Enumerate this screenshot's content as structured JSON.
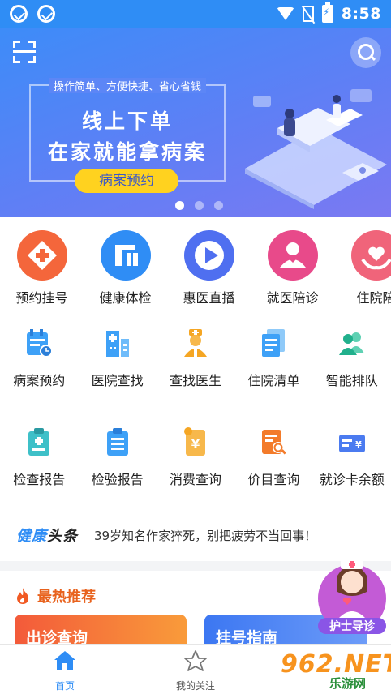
{
  "status_bar": {
    "time": "8:58"
  },
  "banner": {
    "tagline": "操作简单、方便快捷、省心省钱",
    "title_line1": "线上下单",
    "title_line2": "在家就能拿病案",
    "button_label": "病案预约",
    "slide_count": 3,
    "active_slide": 1
  },
  "top_services": [
    {
      "label": "预约挂号",
      "icon": "plus-diamond-icon",
      "color": "#f4663b"
    },
    {
      "label": "健康体检",
      "icon": "checkup-icon",
      "color": "#2f8df5"
    },
    {
      "label": "惠医直播",
      "icon": "play-icon",
      "color": "#4f6ff0"
    },
    {
      "label": "就医陪诊",
      "icon": "companion-icon",
      "color": "#e84a8a"
    },
    {
      "label": "住院陪",
      "icon": "hands-heart-icon",
      "color": "#f0647a"
    }
  ],
  "grid": {
    "row1": [
      {
        "label": "病案预约",
        "icon": "calendar-clock-icon"
      },
      {
        "label": "医院查找",
        "icon": "hospital-building-icon"
      },
      {
        "label": "查找医生",
        "icon": "doctor-icon"
      },
      {
        "label": "住院清单",
        "icon": "list-document-icon"
      },
      {
        "label": "智能排队",
        "icon": "people-queue-icon"
      }
    ],
    "row2": [
      {
        "label": "检查报告",
        "icon": "checkup-report-icon"
      },
      {
        "label": "检验报告",
        "icon": "lab-report-icon"
      },
      {
        "label": "消费查询",
        "icon": "yuan-receipt-icon"
      },
      {
        "label": "价目查询",
        "icon": "price-search-icon"
      },
      {
        "label": "就诊卡余额",
        "icon": "card-yuan-icon"
      }
    ]
  },
  "news": {
    "logo_part1": "健康",
    "logo_part2": "头条",
    "headline": "39岁知名作家猝死，别把疲劳不当回事！"
  },
  "hot": {
    "title": "最热推荐",
    "cards": [
      "出诊查询",
      "挂号指南"
    ]
  },
  "nurse_badge": {
    "label": "护士导诊"
  },
  "bottom_nav": [
    {
      "label": "首页",
      "icon": "home-icon",
      "active": true
    },
    {
      "label": "我的关注",
      "icon": "star-icon",
      "active": false
    }
  ],
  "watermark": {
    "logo": "962.NET",
    "sub": "乐游网"
  },
  "colors": {
    "primary": "#2f8df5",
    "hot": "#e8621d",
    "banner_button": "#ffd21f"
  }
}
